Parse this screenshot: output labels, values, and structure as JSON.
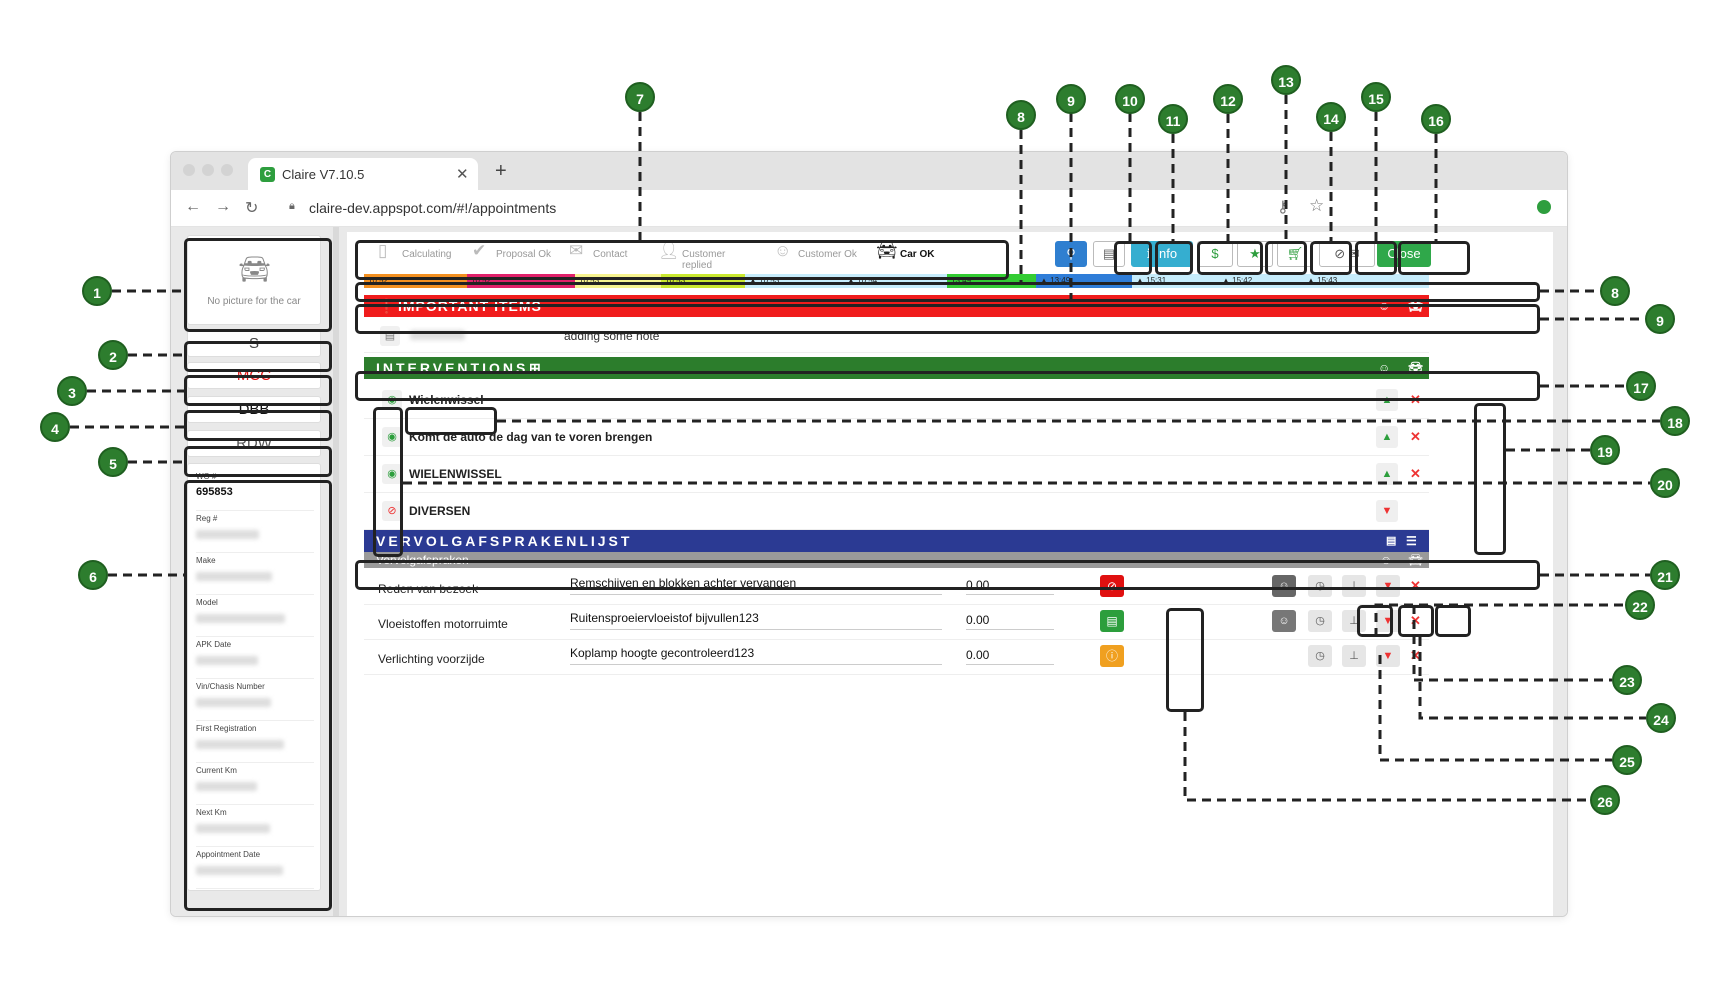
{
  "browser": {
    "tab_title": "Claire V7.10.5",
    "tab_favicon": "C",
    "url": "claire-dev.appspot.com/#!/appointments"
  },
  "sidebar": {
    "no_picture": "No picture for the car",
    "btn_s": "S",
    "btn_mcc": "MCC",
    "btn_dbb": "DBB",
    "btn_rdw": "RDW",
    "fields": [
      {
        "label": "WO #",
        "value": "695853"
      },
      {
        "label": "Reg #",
        "value": ""
      },
      {
        "label": "Make",
        "value": ""
      },
      {
        "label": "Model",
        "value": ""
      },
      {
        "label": "APK Date",
        "value": ""
      },
      {
        "label": "Vin/Chasis Number",
        "value": ""
      },
      {
        "label": "First Registration",
        "value": ""
      },
      {
        "label": "Current Km",
        "value": ""
      },
      {
        "label": "Next Km",
        "value": ""
      },
      {
        "label": "Appointment Date",
        "value": ""
      }
    ]
  },
  "status_steps": [
    "Calculating",
    "Proposal Ok",
    "Contact",
    "Customer replied",
    "Customer Ok",
    "Car OK"
  ],
  "toolbar": {
    "info_label": "Info",
    "close_label": "Close"
  },
  "timeline": [
    {
      "time": "10:52",
      "color": "#f39020"
    },
    {
      "time": "10:52",
      "color": "#e0206a"
    },
    {
      "time": "10:53",
      "color": "#f6f38f"
    },
    {
      "time": "10:53",
      "color": "#c9e830"
    },
    {
      "time": "10:53",
      "color": "#c6ecfb"
    },
    {
      "time": "10:54",
      "color": "#c6ecfb"
    },
    {
      "time": "13:49",
      "color": "#33cc33"
    },
    {
      "time": "13:49",
      "color": "#2f7dd8"
    },
    {
      "time": "15:31",
      "color": "#c6ecfb"
    },
    {
      "time": "15:42",
      "color": "#c6ecfb"
    },
    {
      "time": "15:43",
      "color": "#c6ecfb"
    }
  ],
  "important": {
    "title": "IMPORTANT ITEMS",
    "note_text": "adding some note"
  },
  "interventions": {
    "title": "INTERVENTIONS",
    "items": [
      "Wielenwissel",
      "Komt de auto de dag van te voren brengen",
      "WIELENWISSEL",
      "DIVERSEN"
    ]
  },
  "followup": {
    "title": "VERVOLGAFSPRAKENLIJST",
    "subtitle": "Vervolgafspraken",
    "rows": [
      {
        "label": "Reden van bezoek",
        "text": "Remschijven en blokken achter vervangen",
        "amount": "0.00"
      },
      {
        "label": "Vloeistoffen motorruimte",
        "text": "Ruitensproeiervloeistof bijvullen123",
        "amount": "0.00"
      },
      {
        "label": "Verlichting voorzijde",
        "text": "Koplamp hoogte gecontroleerd123",
        "amount": "0.00"
      }
    ]
  },
  "callouts": [
    "1",
    "2",
    "3",
    "4",
    "5",
    "6",
    "7",
    "8",
    "9",
    "10",
    "11",
    "12",
    "13",
    "14",
    "15",
    "16",
    "17",
    "18",
    "19",
    "20",
    "21",
    "22",
    "23",
    "24",
    "25",
    "26"
  ],
  "colors": {
    "important_red": "#f01c1c",
    "interventions_green": "#2c7d2c",
    "followup_blue": "#2b3a93",
    "badge_green": "#2d7d2e"
  }
}
